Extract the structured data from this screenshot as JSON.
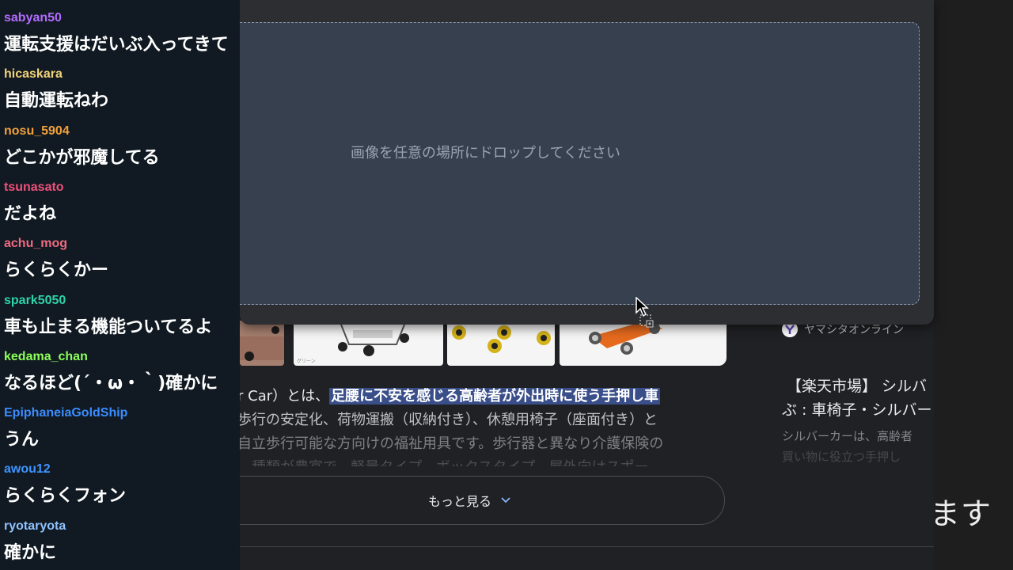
{
  "chat": {
    "messages": [
      {
        "user": "sabyan50",
        "text": "運転支援はだいぶ入ってきて",
        "color": "#b36bff"
      },
      {
        "user": "hicaskara",
        "text": "自動運転ねわ",
        "color": "#f3d37a"
      },
      {
        "user": "nosu_5904",
        "text": "どこかが邪魔してる",
        "color": "#f3a13a"
      },
      {
        "user": "tsunasato",
        "text": "だよね",
        "color": "#f0507a"
      },
      {
        "user": "achu_mog",
        "text": "らくらくかー",
        "color": "#ef6a80"
      },
      {
        "user": "spark5050",
        "text": "車も止まる機能ついてるよ",
        "color": "#2fd1a8"
      },
      {
        "user": "kedama_chan",
        "text": "なるほど(´・ω・｀)確かに",
        "color": "#8cff5a"
      },
      {
        "user": "EpiphaneiaGoldShip",
        "text": "うん",
        "color": "#3b8cff"
      },
      {
        "user": "awou12",
        "text": "らくらくフォン",
        "color": "#3f94ff"
      },
      {
        "user": "ryotaryota",
        "text": "確かに",
        "color": "#8ec2ff"
      }
    ]
  },
  "dialog": {
    "drop_text": "画像を任意の場所にドロップしてください"
  },
  "results": {
    "thumb_caption": "グリーン",
    "description": {
      "line1_prefix": "r Car）とは、",
      "line1_highlight": "足腰に不安を感じる高齢者が外出時に使う手押し車",
      "line2": "歩行の安定化、荷物運搬（収納付き）、休憩用椅子（座面付き）と",
      "line3": "自立歩行可能な方向けの福祉用具です。歩行器と異なり介護保険の",
      "line4": "、種類が豊富で、軽量タイプ、ボックスタイプ、屋外向けスポー"
    },
    "more_label": "もっと見る",
    "side_card": {
      "site_name": "ヤマシタオンライン",
      "title_line1": "【楽天市場】 シルバ",
      "title_line2": "ぶ : 車椅子・シルバー",
      "snippet_line1": "シルバーカーは、高齢者",
      "snippet_line2": "買い物に役立つ手押し"
    }
  },
  "overlay_text": "ます"
}
